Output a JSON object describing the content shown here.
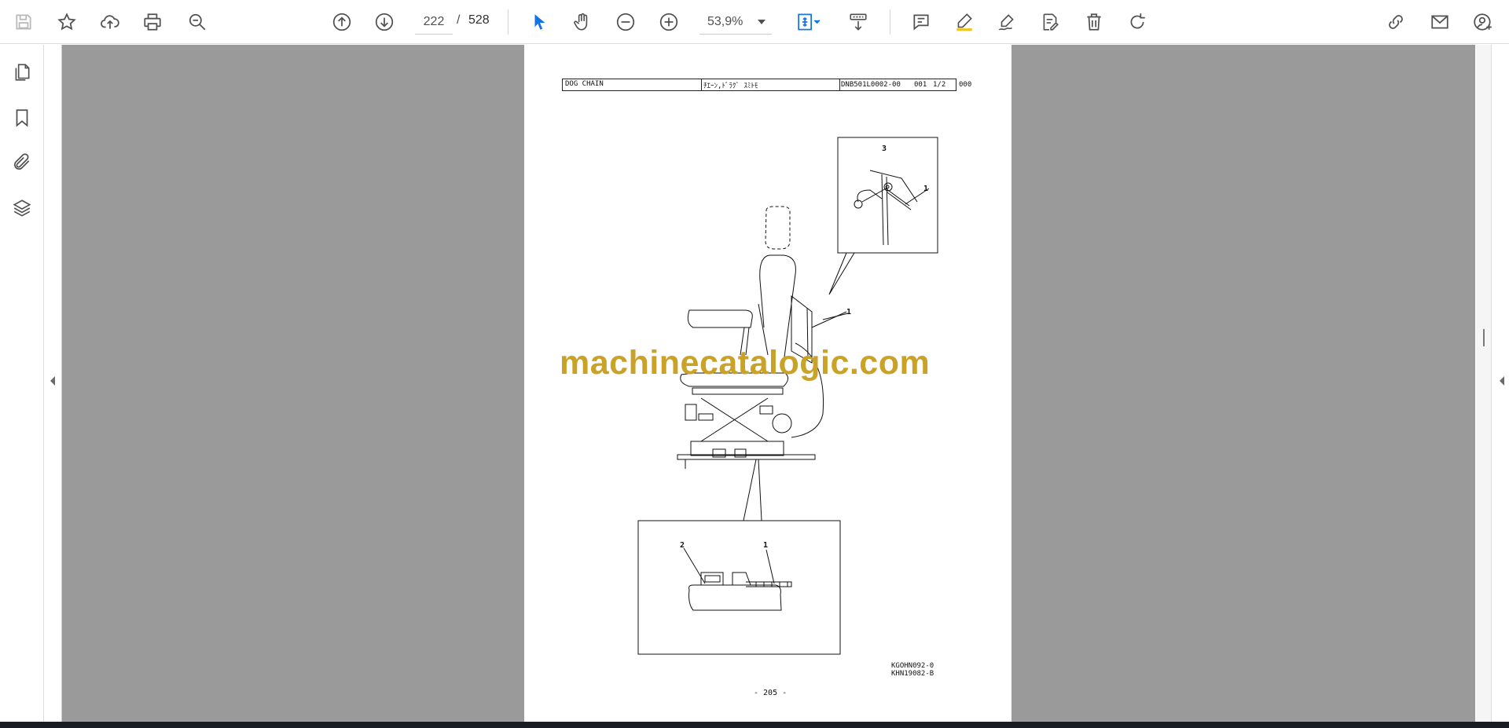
{
  "toolbar": {
    "page_current": "222",
    "page_separator": "/",
    "page_total": "528",
    "zoom_value": "53,9%",
    "accent_color": "#1473e6"
  },
  "icons": [
    "save-icon",
    "bookmark-star-icon",
    "upload-icon",
    "print-icon",
    "find-icon",
    "prev-page-icon",
    "next-page-icon",
    "select-pointer-icon",
    "hand-pan-icon",
    "zoom-out-icon",
    "zoom-in-icon",
    "fit-page-icon",
    "scroll-mode-icon",
    "comment-icon",
    "highlight-pen-icon",
    "sign-icon",
    "edit-pdf-icon",
    "delete-icon",
    "rotate-icon",
    "share-link-icon",
    "email-icon",
    "account-icon",
    "pages-thumbnail-icon",
    "bookmarks-icon",
    "attachments-icon",
    "layers-icon"
  ],
  "document": {
    "header_title": "DOG CHAIN",
    "header_japanese": "ﾁｴｰﾝ,ﾄﾞﾗｸﾞ ｽﾐﾄﾓ",
    "header_code": "DNB501L0002-00",
    "header_seq": "001",
    "header_sheet": "1/2",
    "header_extra": "000",
    "callout_top_3": "3",
    "callout_top_1": "1",
    "callout_seat_1": "1",
    "callout_bottom_2": "2",
    "callout_bottom_1": "1",
    "ref_code_1": "KGOHN092-0",
    "ref_code_2": "KHN19082-B",
    "page_number": "- 205 -"
  },
  "watermark": "machinecatalogic.com"
}
